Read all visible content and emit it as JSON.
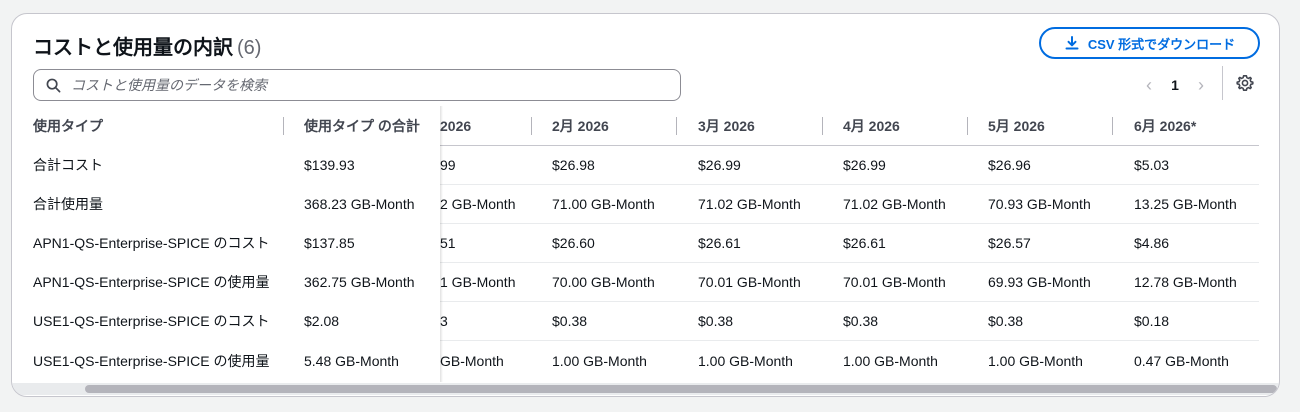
{
  "header": {
    "title": "コストと使用量の内訳",
    "count": "(6)",
    "csv_button_label": "CSV 形式でダウンロード"
  },
  "search": {
    "placeholder": "コストと使用量のデータを検索"
  },
  "pagination": {
    "current_page": "1",
    "prev_icon": "chevron-left-icon",
    "next_icon": "chevron-right-icon"
  },
  "settings": {
    "icon": "gear-icon"
  },
  "table": {
    "headers": [
      "使用タイプ",
      "使用タイプ の合計",
      "2026",
      "2月 2026",
      "3月 2026",
      "4月 2026",
      "5月 2026",
      "6月 2026*"
    ],
    "rows": [
      [
        "合計コスト",
        "$139.93",
        "99",
        "$26.98",
        "$26.99",
        "$26.99",
        "$26.96",
        "$5.03"
      ],
      [
        "合計使用量",
        "368.23 GB-Month",
        "2 GB-Month",
        "71.00 GB-Month",
        "71.02 GB-Month",
        "71.02 GB-Month",
        "70.93 GB-Month",
        "13.25 GB-Month"
      ],
      [
        "APN1-QS-Enterprise-SPICE のコスト",
        "$137.85",
        "51",
        "$26.60",
        "$26.61",
        "$26.61",
        "$26.57",
        "$4.86"
      ],
      [
        "APN1-QS-Enterprise-SPICE の使用量",
        "362.75 GB-Month",
        "1 GB-Month",
        "70.00 GB-Month",
        "70.01 GB-Month",
        "70.01 GB-Month",
        "69.93 GB-Month",
        "12.78 GB-Month"
      ],
      [
        "USE1-QS-Enterprise-SPICE のコスト",
        "$2.08",
        "3",
        "$0.38",
        "$0.38",
        "$0.38",
        "$0.38",
        "$0.18"
      ],
      [
        "USE1-QS-Enterprise-SPICE の使用量",
        "5.48 GB-Month",
        "GB-Month",
        "1.00 GB-Month",
        "1.00 GB-Month",
        "1.00 GB-Month",
        "1.00 GB-Month",
        "0.47 GB-Month"
      ]
    ]
  },
  "colors": {
    "accent": "#006ce0",
    "border": "#c6c6cd",
    "text": "#0f141a",
    "muted": "#656871"
  }
}
